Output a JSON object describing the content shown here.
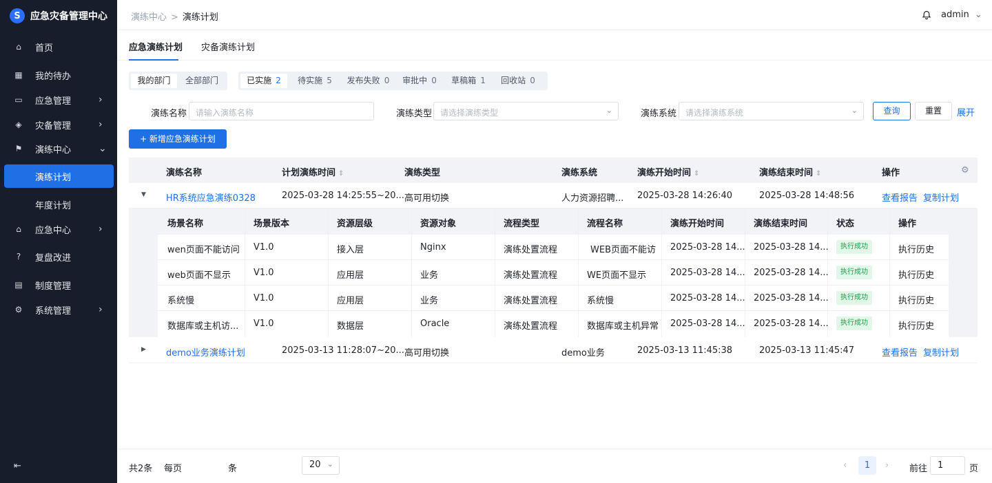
{
  "app": {
    "title": "应急灾备管理中心",
    "logo_glyph": "S"
  },
  "sidebar": {
    "items": [
      {
        "label": "首页",
        "icon": "home-icon",
        "glyph": "⌂"
      },
      {
        "label": "我的待办",
        "icon": "calendar-icon",
        "glyph": "▦"
      },
      {
        "label": "应急管理",
        "icon": "monitor-icon",
        "glyph": "▭"
      },
      {
        "label": "灾备管理",
        "icon": "layers-icon",
        "glyph": "◈"
      },
      {
        "label": "演练中心",
        "icon": "drill-icon",
        "glyph": "⚑"
      },
      {
        "label": "演练计划",
        "icon": "",
        "glyph": ""
      },
      {
        "label": "年度计划",
        "icon": "",
        "glyph": ""
      },
      {
        "label": "应急中心",
        "icon": "building-icon",
        "glyph": "⌂"
      },
      {
        "label": "复盘改进",
        "icon": "question-icon",
        "glyph": "?"
      },
      {
        "label": "制度管理",
        "icon": "document-icon",
        "glyph": "▤"
      },
      {
        "label": "系统管理",
        "icon": "settings-icon",
        "glyph": "⚙"
      }
    ],
    "collapse_glyph": "⇤",
    "active_color": "#1f6fe5"
  },
  "header": {
    "breadcrumb": [
      "演练中心",
      "演练计划"
    ],
    "breadcrumb_sep": ">",
    "user": "admin",
    "user_caret": "⌄"
  },
  "tabs": [
    "应急演练计划",
    "灾备演练计划"
  ],
  "filters": {
    "dept": [
      "我的部门",
      "全部部门"
    ],
    "status": [
      {
        "label": "已实施",
        "count": "2"
      },
      {
        "label": "待实施",
        "count": "5"
      },
      {
        "label": "发布失败",
        "count": "0"
      },
      {
        "label": "审批中",
        "count": "0"
      },
      {
        "label": "草稿箱",
        "count": "1"
      },
      {
        "label": "回收站",
        "count": "0"
      }
    ],
    "name_label": "演练名称",
    "name_placeholder": "请输入演练名称",
    "type_label": "演练类型",
    "type_placeholder": "请选择演练类型",
    "system_label": "演练系统",
    "system_placeholder": "请选择演练系统",
    "query": "查询",
    "reset": "重置",
    "expand": "展开",
    "dropdown_glyph": "⌄"
  },
  "add_button": "+ 新增应急演练计划",
  "table": {
    "headers": [
      "演练名称",
      "计划演练时间",
      "演练类型",
      "演练系统",
      "演练开始时间",
      "演练结束时间",
      "操作"
    ],
    "sort_glyph": "⇕",
    "settings_glyph": "⚙",
    "rows": [
      {
        "caret": "▼",
        "name": "HR系统应急演练0328",
        "plan_time": "2025-03-28 14:25:55~20...",
        "type": "高可用切换",
        "system": "人力资源招聘...",
        "start": "2025-03-28 14:26:40",
        "end": "2025-03-28 14:48:56",
        "op1": "查看报告",
        "op2": "复制计划"
      },
      {
        "caret": "▶",
        "name": "demo业务演练计划",
        "plan_time": "2025-03-13 11:28:07~20...",
        "type": "高可用切换",
        "system": "demo业务",
        "start": "2025-03-13 11:45:38",
        "end": "2025-03-13 11:45:47",
        "op1": "查看报告",
        "op2": "复制计划"
      }
    ]
  },
  "subtable": {
    "headers": [
      "场景名称",
      "场景版本",
      "资源层级",
      "资源对象",
      "流程类型",
      "流程名称",
      "演练开始时间",
      "演练结束时间",
      "状态",
      "操作"
    ],
    "rows": [
      {
        "scene": "wen页面不能访问",
        "version": "V1.0",
        "layer": "接入层",
        "object": "Nginx",
        "flow_type": "演练处置流程",
        "flow_name": "WEB页面不能访",
        "start": "2025-03-28 14...",
        "end": "2025-03-28 14...",
        "status": "执行成功",
        "op": "执行历史"
      },
      {
        "scene": "web页面不显示",
        "version": "V1.0",
        "layer": "应用层",
        "object": "业务",
        "flow_type": "演练处置流程",
        "flow_name": "WE页面不显示",
        "start": "2025-03-28 14...",
        "end": "2025-03-28 14...",
        "status": "执行成功",
        "op": "执行历史"
      },
      {
        "scene": "系统慢",
        "version": "V1.0",
        "layer": "应用层",
        "object": "业务",
        "flow_type": "演练处置流程",
        "flow_name": "系统慢",
        "start": "2025-03-28 14...",
        "end": "2025-03-28 14...",
        "status": "执行成功",
        "op": "执行历史"
      },
      {
        "scene": "数据库或主机访...",
        "version": "V1.0",
        "layer": "数据层",
        "object": "Oracle",
        "flow_type": "演练处置流程",
        "flow_name": "数据库或主机异常",
        "start": "2025-03-28 14...",
        "end": "2025-03-28 14...",
        "status": "执行成功",
        "op": "执行历史"
      }
    ]
  },
  "pagination": {
    "total": "共2条",
    "per_page": "每页",
    "size": "20",
    "unit": "条",
    "prev": "‹",
    "current": "1",
    "next": "›",
    "goto": "前往",
    "goto_value": "1",
    "page_unit": "页"
  }
}
